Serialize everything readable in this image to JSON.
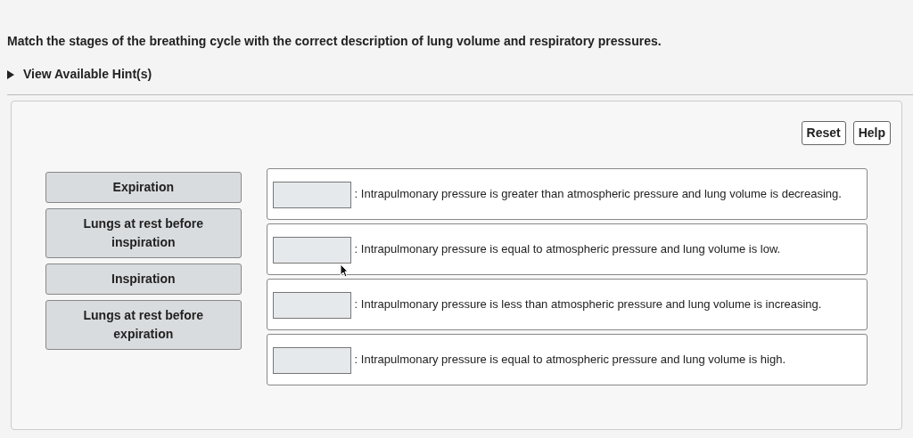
{
  "instruction": "Match the stages of the breathing cycle with the correct description of lung volume and respiratory pressures.",
  "hint_toggle": {
    "label": "View Available Hint(s)",
    "expanded": false
  },
  "buttons": [
    "Reset",
    "Help"
  ],
  "labels": [
    "Expiration",
    "Lungs at rest before inspiration",
    "Inspiration",
    "Lungs at rest before expiration"
  ],
  "targets": [
    {
      "text": ": Intrapulmonary pressure is greater than atmospheric pressure and lung volume is decreasing."
    },
    {
      "text": ": Intrapulmonary pressure is equal to atmospheric pressure and lung volume is low."
    },
    {
      "text": ": Intrapulmonary pressure is less than atmospheric pressure and lung volume is increasing."
    },
    {
      "text": ": Intrapulmonary pressure is equal to atmospheric pressure and lung volume is high."
    }
  ]
}
